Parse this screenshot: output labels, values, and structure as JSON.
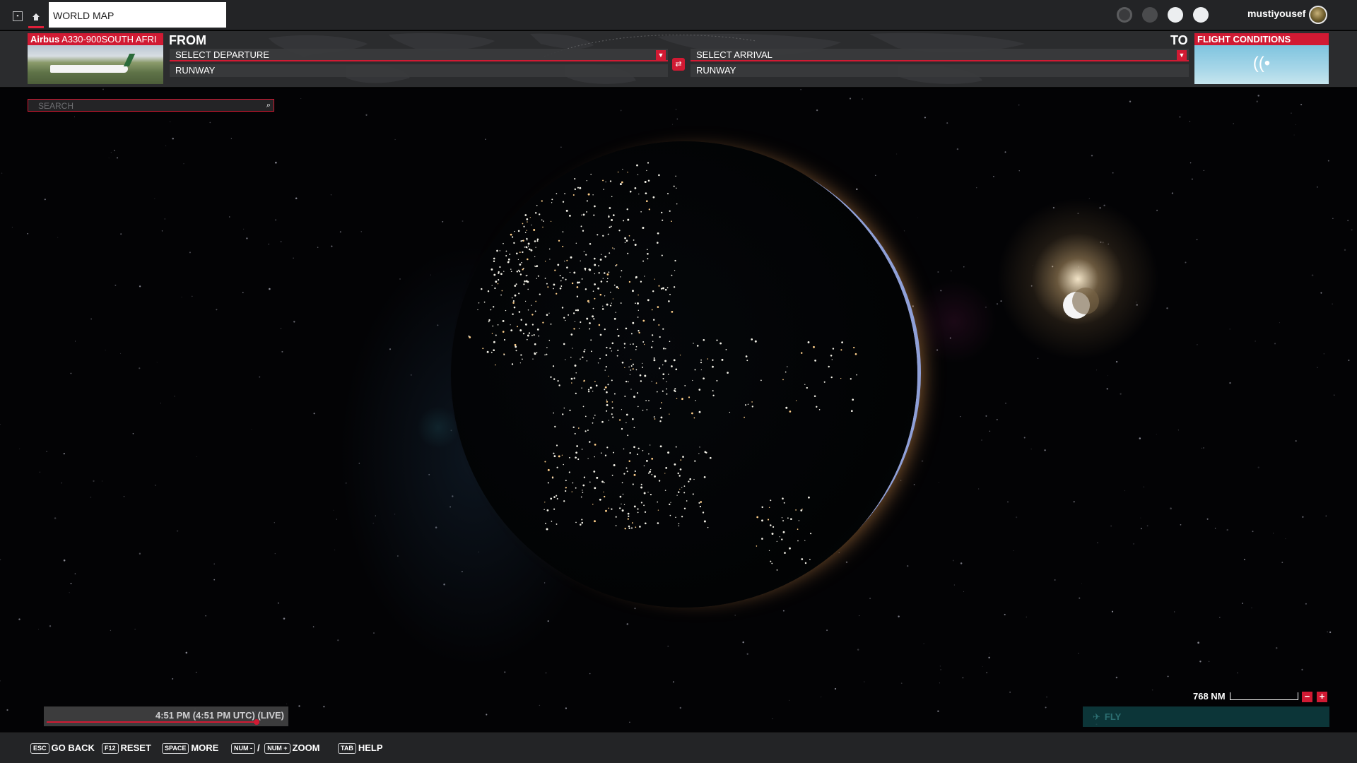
{
  "topbar": {
    "tab_title": "WORLD MAP",
    "username": "mustiyousef",
    "icons": [
      "square-icon",
      "home-icon",
      "activity-icon",
      "friends-icon",
      "profile-icon",
      "notifications-icon"
    ]
  },
  "aircraft": {
    "brand": "Airbus",
    "model": "A330-900SOUTH AFRI"
  },
  "route": {
    "from_label": "FROM",
    "to_label": "TO",
    "departure_value": "SELECT DEPARTURE",
    "departure_runway": "RUNWAY",
    "arrival_value": "SELECT ARRIVAL",
    "arrival_runway": "RUNWAY"
  },
  "flight_conditions": {
    "title": "FLIGHT CONDITIONS"
  },
  "search": {
    "placeholder": "SEARCH"
  },
  "time": {
    "text": "4:51 PM (4:51 PM UTC) (LIVE)"
  },
  "scale": {
    "text": "768 NM",
    "zoom_out": "−",
    "zoom_in": "+"
  },
  "fly": {
    "label": "FLY"
  },
  "hints": [
    {
      "key": "ESC",
      "label": "GO BACK"
    },
    {
      "key": "F12",
      "label": "RESET"
    },
    {
      "key": "SPACE",
      "label": "MORE"
    },
    {
      "key": "NUM -",
      "separator": "/",
      "key2": "NUM +",
      "label": "ZOOM"
    },
    {
      "key": "TAB",
      "label": "HELP"
    }
  ],
  "colors": {
    "accent": "#d11a33",
    "bar": "#232426",
    "space": "#030305"
  }
}
